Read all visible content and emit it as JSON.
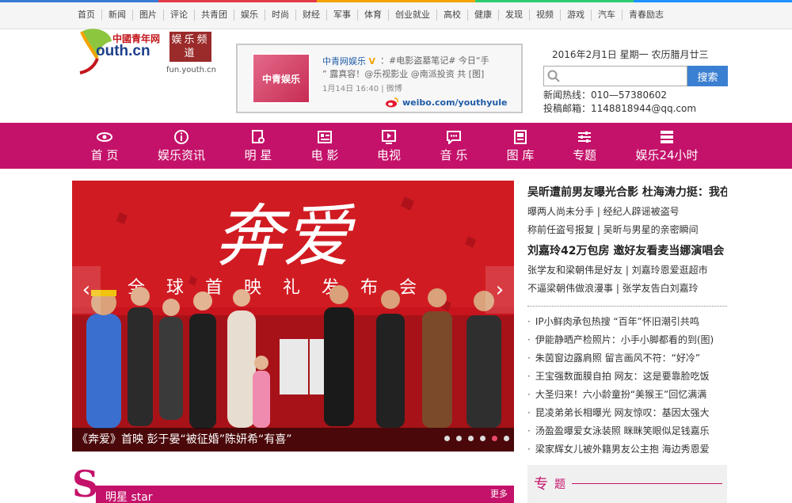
{
  "topnav": [
    "首页",
    "新闻",
    "图片",
    "评论",
    "共青团",
    "娱乐",
    "时尚",
    "财经",
    "军事",
    "体育",
    "创业就业",
    "高校",
    "健康",
    "发现",
    "视频",
    "游戏",
    "汽车",
    "青春励志"
  ],
  "logo": {
    "cn": "中國青年网",
    "en": "outh.cn",
    "seal": "娱乐频道",
    "sub": "fun.youth.cn"
  },
  "weibo": {
    "thumb_text": "中青娱乐",
    "name": "中青网娱乐",
    "badge": "V",
    "text": "：#电影盗墓笔记# 今日“手",
    "text2": "” 露真容！@乐视影业 @南派投资 共 [图]",
    "meta": "1月14日 16:40 | 微博",
    "link": "weibo.com/youthyule"
  },
  "date": "2016年2月1日   星期一   农历腊月廿三",
  "search": {
    "placeholder": "",
    "button": "搜索"
  },
  "contact": {
    "hotline": "新闻热线：010—57380602",
    "email": "投稿邮箱：1148818944@qq.com"
  },
  "mainnav": [
    {
      "label": "首 页",
      "icon": "eye-icon"
    },
    {
      "label": "娱乐资讯",
      "icon": "info-icon"
    },
    {
      "label": "明 星",
      "icon": "star-icon"
    },
    {
      "label": "电 影",
      "icon": "film-icon"
    },
    {
      "label": "电视",
      "icon": "tv-icon"
    },
    {
      "label": "音 乐",
      "icon": "music-icon"
    },
    {
      "label": "图 库",
      "icon": "image-icon"
    },
    {
      "label": "专题",
      "icon": "topic-icon"
    },
    {
      "label": "娱乐24小时",
      "icon": "list-icon"
    }
  ],
  "slider": {
    "title_art": "奔爱",
    "subtitle_art": "全 球 首 映 礼 发 布 会",
    "caption": "《奔爱》首映 彭于晏“被征婚”陈妍希“有喜”",
    "dots": 6,
    "active_dot": 4
  },
  "news": {
    "headline1": "吴昕遭前男友曝光合影 杜海涛力挺：我在",
    "sub1a": "曝两人尚未分手 | 经纪人辟谣被盗号",
    "sub1b": "称前任盗号报复 | 吴昕与男星的亲密瞬间",
    "headline2": "刘嘉玲42万包房 邀好友看麦当娜演唱会",
    "sub2a": "张学友和梁朝伟是好友 | 刘嘉玲恩爱逛超市",
    "sub2b": "不逼梁朝伟做浪漫事 | 张学友告白刘嘉玲",
    "list": [
      "IP小鲜肉承包热搜 “百年”怀旧潮引共鸣",
      "伊能静晒产检照片：小手小脚都看的到(图)",
      "朱茵窗边露肩照 留言画风不符：“好冷”",
      "王宝强数面膜自拍 网友：这是要靠脸吃饭",
      "大圣归来！六小龄童扮“美猴王”回忆满满",
      "昆凌弟弟长相曝光 网友惊叹：基因太强大",
      "汤盈盈曝爱女泳装照 眯眯笑眼似足钱嘉乐",
      "梁家辉女儿被外籍男友公主抱 海边秀恩爱"
    ]
  },
  "stars": {
    "letter": "S",
    "title": "明星 star",
    "more": "更多"
  },
  "zt": {
    "t1": "专",
    "t2": "题"
  }
}
